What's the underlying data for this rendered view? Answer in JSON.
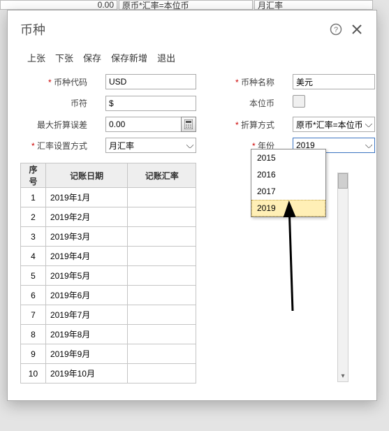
{
  "bg": {
    "val_left": "0.00",
    "val_mid": "原币*汇率=本位币",
    "val_right": "月汇率"
  },
  "dialog": {
    "title": "币种",
    "menu": [
      "上张",
      "下张",
      "保存",
      "保存新增",
      "退出"
    ],
    "labels": {
      "code": "币种代码",
      "name": "币种名称",
      "symbol": "币符",
      "base": "本位币",
      "maxdiff": "最大折算误差",
      "convmode": "折算方式",
      "ratemode": "汇率设置方式",
      "year": "年份"
    },
    "values": {
      "code": "USD",
      "name": "美元",
      "symbol": "$",
      "maxdiff": "0.00",
      "convmode": "原币*汇率=本位币",
      "ratemode": "月汇率",
      "year": "2019"
    },
    "year_options": [
      "2015",
      "2016",
      "2017",
      "2019"
    ],
    "year_selected_index": 3,
    "table": {
      "headers": [
        "序号",
        "记账日期",
        "记账汇率"
      ],
      "rows": [
        {
          "seq": "1",
          "date": "2019年1月",
          "rate": ""
        },
        {
          "seq": "2",
          "date": "2019年2月",
          "rate": ""
        },
        {
          "seq": "3",
          "date": "2019年3月",
          "rate": ""
        },
        {
          "seq": "4",
          "date": "2019年4月",
          "rate": ""
        },
        {
          "seq": "5",
          "date": "2019年5月",
          "rate": ""
        },
        {
          "seq": "6",
          "date": "2019年6月",
          "rate": ""
        },
        {
          "seq": "7",
          "date": "2019年7月",
          "rate": ""
        },
        {
          "seq": "8",
          "date": "2019年8月",
          "rate": ""
        },
        {
          "seq": "9",
          "date": "2019年9月",
          "rate": ""
        },
        {
          "seq": "10",
          "date": "2019年10月",
          "rate": ""
        }
      ]
    }
  }
}
